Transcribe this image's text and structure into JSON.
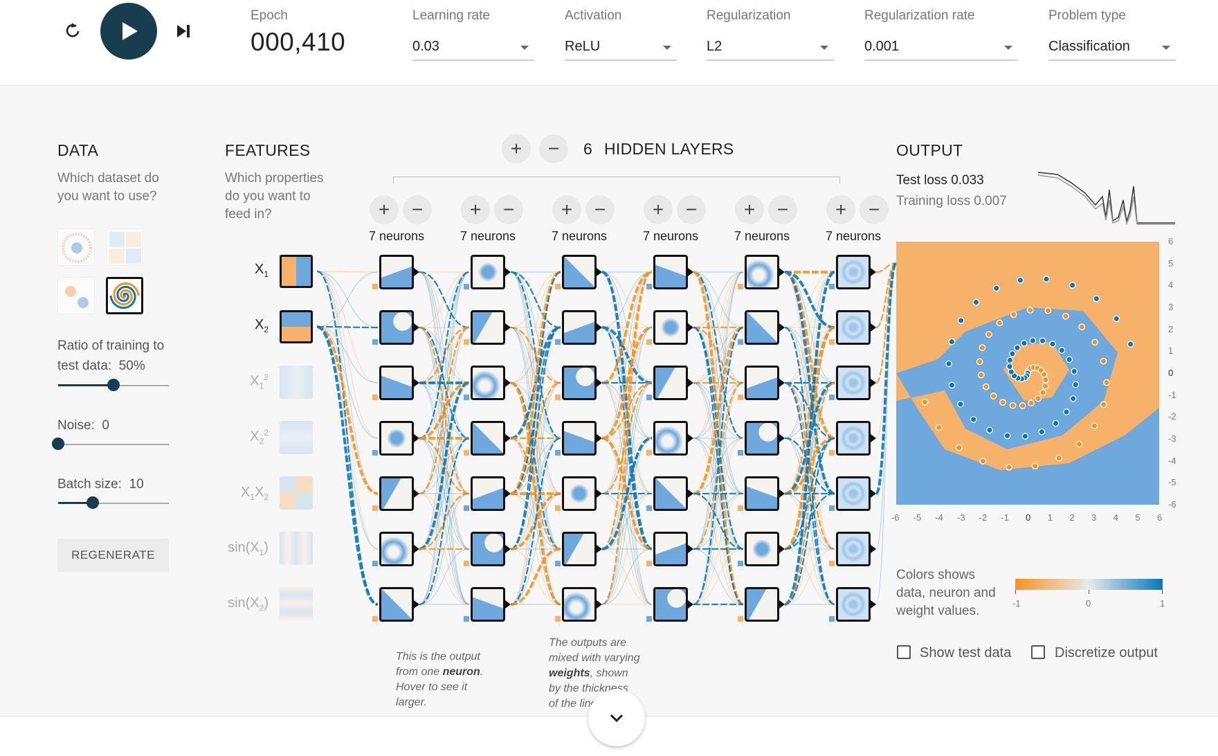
{
  "controls": {
    "epoch_label": "Epoch",
    "epoch_value": "000,410",
    "learning_rate": {
      "label": "Learning rate",
      "value": "0.03"
    },
    "activation": {
      "label": "Activation",
      "value": "ReLU"
    },
    "regularization": {
      "label": "Regularization",
      "value": "L2"
    },
    "regularization_rate": {
      "label": "Regularization rate",
      "value": "0.001"
    },
    "problem_type": {
      "label": "Problem type",
      "value": "Classification"
    }
  },
  "data": {
    "title": "DATA",
    "subtitle_line1": "Which dataset do",
    "subtitle_line2": "you want to use?",
    "datasets": [
      "circle",
      "xor",
      "gaussian",
      "spiral"
    ],
    "selected_dataset": "spiral",
    "ratio_label": "Ratio of training to",
    "ratio_label2": "test data:",
    "ratio_value": "50%",
    "ratio_fraction": 0.5,
    "noise_label": "Noise:",
    "noise_value": "0",
    "noise_fraction": 0.0,
    "batch_label": "Batch size:",
    "batch_value": "10",
    "batch_fraction": 0.31,
    "regenerate": "REGENERATE"
  },
  "features": {
    "title": "FEATURES",
    "subtitle_line1": "Which properties",
    "subtitle_line2": "do you want to",
    "subtitle_line3": "feed in?",
    "items": [
      {
        "id": "x1",
        "label": "X1",
        "active": true
      },
      {
        "id": "x2",
        "label": "X2",
        "active": true
      },
      {
        "id": "x1sq",
        "label": "X1²",
        "active": false
      },
      {
        "id": "x2sq",
        "label": "X2²",
        "active": false
      },
      {
        "id": "x1x2",
        "label": "X1X2",
        "active": false
      },
      {
        "id": "sinx1",
        "label": "sin(X1)",
        "active": false
      },
      {
        "id": "sinx2",
        "label": "sin(X2)",
        "active": false
      }
    ]
  },
  "network": {
    "hidden_layers_count": "6",
    "hidden_layers_label": "HIDDEN LAYERS",
    "add_layer": "+",
    "remove_layer": "−",
    "layers": [
      {
        "neurons_label": "7 neurons"
      },
      {
        "neurons_label": "7 neurons"
      },
      {
        "neurons_label": "7 neurons"
      },
      {
        "neurons_label": "7 neurons"
      },
      {
        "neurons_label": "7 neurons"
      },
      {
        "neurons_label": "7 neurons"
      }
    ],
    "annotation_neuron": {
      "t1": "This is the output",
      "t2": "from one",
      "t3": "neuron",
      "t4": ".",
      "t5": "Hover to see it",
      "t6": "larger."
    },
    "annotation_weights": {
      "t1": "The outputs are",
      "t2": "mixed with varying",
      "t3": "weights",
      "t4": ", shown",
      "t5": "by the thickness",
      "t6": "of the lines."
    }
  },
  "output": {
    "title": "OUTPUT",
    "test_loss_label": "Test loss",
    "test_loss_value": "0.033",
    "training_loss_label": "Training loss",
    "training_loss_value": "0.007",
    "x_ticks": [
      "-6",
      "-5",
      "-4",
      "-3",
      "-2",
      "-1",
      "0",
      "1",
      "2",
      "3",
      "4",
      "5",
      "6"
    ],
    "y_ticks": [
      "6",
      "5",
      "4",
      "3",
      "2",
      "1",
      "0",
      "-1",
      "-2",
      "-3",
      "-4",
      "-5",
      "-6"
    ],
    "legend_line1": "Colors shows",
    "legend_line2": "data, neuron and",
    "legend_line3": "weight values.",
    "legend_min": "-1",
    "legend_mid": "0",
    "legend_max": "1",
    "show_test_data": "Show test data",
    "discretize_output": "Discretize output"
  },
  "colors": {
    "orange": "#f59322",
    "blue": "#0877bd",
    "dark": "#183d4e",
    "light_orange": "#f6b26b",
    "light_blue": "#6fa8dc"
  }
}
